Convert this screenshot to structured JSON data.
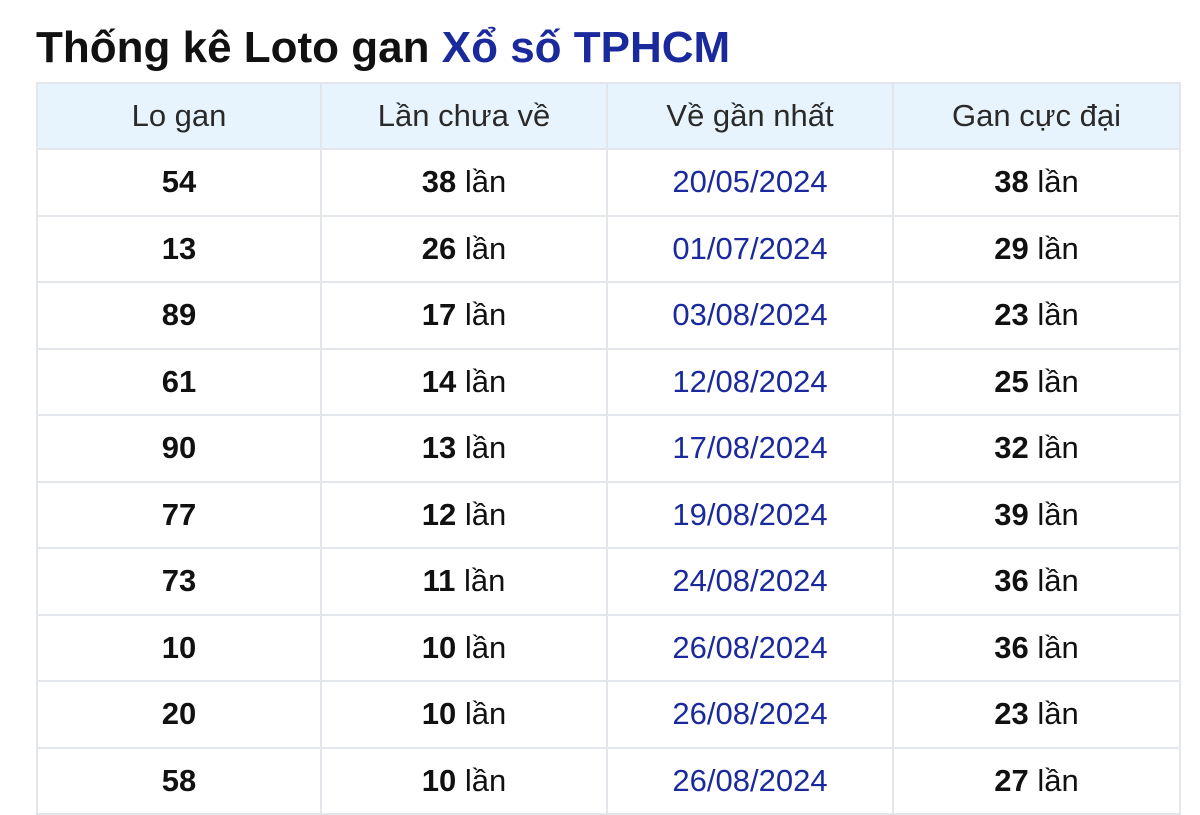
{
  "title": {
    "main": "Thống kê Loto gan",
    "accent": "Xổ số TPHCM"
  },
  "table": {
    "headers": [
      "Lo gan",
      "Lần chưa về",
      "Về gần nhất",
      "Gan cực đại"
    ],
    "unit": "lần",
    "rows": [
      {
        "lo": "54",
        "missed": "38",
        "last": "20/05/2024",
        "max": "38"
      },
      {
        "lo": "13",
        "missed": "26",
        "last": "01/07/2024",
        "max": "29"
      },
      {
        "lo": "89",
        "missed": "17",
        "last": "03/08/2024",
        "max": "23"
      },
      {
        "lo": "61",
        "missed": "14",
        "last": "12/08/2024",
        "max": "25"
      },
      {
        "lo": "90",
        "missed": "13",
        "last": "17/08/2024",
        "max": "32"
      },
      {
        "lo": "77",
        "missed": "12",
        "last": "19/08/2024",
        "max": "39"
      },
      {
        "lo": "73",
        "missed": "11",
        "last": "24/08/2024",
        "max": "36"
      },
      {
        "lo": "10",
        "missed": "10",
        "last": "26/08/2024",
        "max": "36"
      },
      {
        "lo": "20",
        "missed": "10",
        "last": "26/08/2024",
        "max": "23"
      },
      {
        "lo": "58",
        "missed": "10",
        "last": "26/08/2024",
        "max": "27"
      }
    ]
  },
  "colors": {
    "accent": "#1a2a9c",
    "header_bg": "#e8f4fd",
    "border": "#e3e6ea"
  }
}
